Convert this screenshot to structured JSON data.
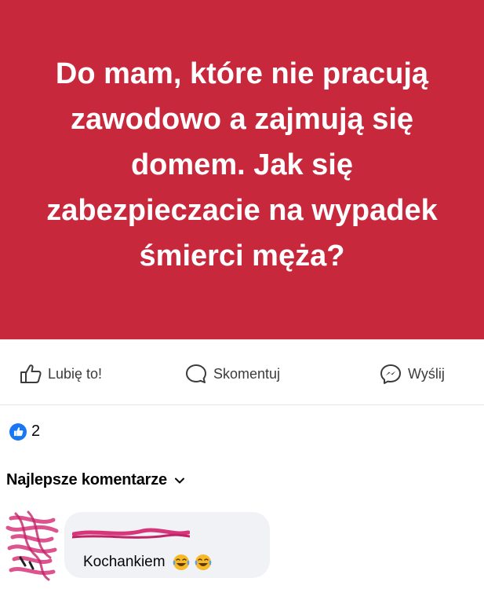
{
  "post": {
    "text": "Do mam, które nie pracują zawodowo a zajmują się domem. Jak się zabezpieczacie na wypadek śmierci męża?",
    "background_color": "#c8283c"
  },
  "actions": {
    "like_label": "Lubię to!",
    "comment_label": "Skomentuj",
    "share_label": "Wyślij"
  },
  "reactions": {
    "icon": "thumbs-up-icon",
    "count": "2"
  },
  "comments": {
    "sort_label": "Najlepsze komentarze",
    "items": [
      {
        "text": "Kochankiem",
        "emojis": [
          "laughing-tears-emoji",
          "laughing-tears-emoji"
        ]
      }
    ]
  }
}
